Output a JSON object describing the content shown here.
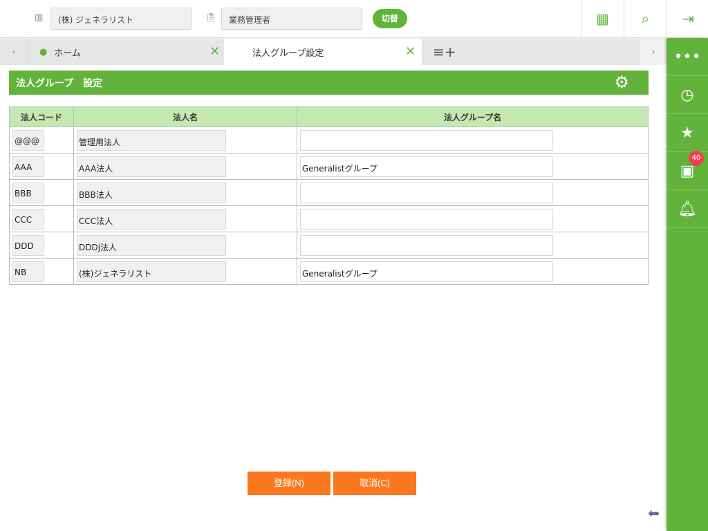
{
  "header": {
    "company": "(株) ジェネラリスト",
    "role": "業務管理者",
    "switch_label": "切替"
  },
  "tabs": [
    {
      "label": "ホーム"
    },
    {
      "label": "法人グループ設定"
    }
  ],
  "sidebar": {
    "badge_count": "40"
  },
  "page": {
    "title": "法人グループ　設定"
  },
  "table": {
    "headers": [
      "法人コード",
      "法人名",
      "法人グループ名"
    ],
    "rows": [
      {
        "code": "@@@",
        "name": "管理用法人",
        "group": ""
      },
      {
        "code": "AAA",
        "name": "AAA法人",
        "group": "Generalistグループ"
      },
      {
        "code": "BBB",
        "name": "BBB法人",
        "group": ""
      },
      {
        "code": "CCC",
        "name": "CCC法人",
        "group": ""
      },
      {
        "code": "DDD",
        "name": "DDDj法人",
        "group": ""
      },
      {
        "code": "NB",
        "name": "(株)ジェネラリスト",
        "group": "Generalistグループ"
      }
    ]
  },
  "buttons": {
    "register": "登録(N)",
    "cancel": "取消(C)"
  }
}
